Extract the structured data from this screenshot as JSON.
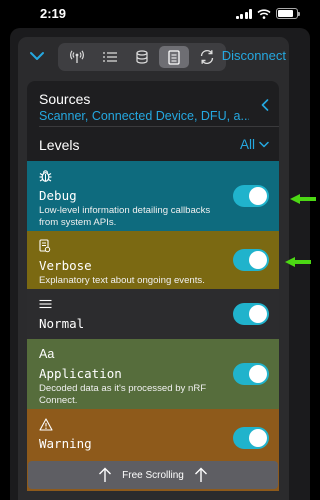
{
  "status_bar": {
    "time": "2:19"
  },
  "toolbar": {
    "disconnect_label": "Disconnect",
    "segments": [
      "antenna-icon",
      "list-icon",
      "database-icon",
      "document-icon",
      "refresh-icon"
    ],
    "active_segment": "document-icon"
  },
  "sources": {
    "title": "Sources",
    "value": "Scanner, Connected Device, DFU, a..."
  },
  "levels": {
    "title": "Levels",
    "filter": "All"
  },
  "log_levels": [
    {
      "icon": "bug-icon",
      "name": "Debug",
      "description": "Low-level information detailing callbacks from system APIs.",
      "enabled": true,
      "color": "#0e6b7e"
    },
    {
      "icon": "note-icon",
      "name": "Verbose",
      "description": "Explanatory text about ongoing events.",
      "enabled": true,
      "color": "#7b6912"
    },
    {
      "icon": "lines-icon",
      "name": "Normal",
      "description": "",
      "enabled": true,
      "color": "#2c2c2e"
    },
    {
      "icon": "aa-icon",
      "name": "Application",
      "description": "Decoded data as it's processed by nRF Connect.",
      "enabled": true,
      "color": "#566d3c"
    },
    {
      "icon": "warning-icon",
      "name": "Warning",
      "description": "",
      "enabled": true,
      "color": "#8e5a1b"
    }
  ],
  "bottom_bar": {
    "label": "Free Scrolling"
  },
  "colors": {
    "accent": "#25a8e0",
    "toggle_on": "#20b3cc",
    "annotation_arrow": "#4cd814"
  }
}
